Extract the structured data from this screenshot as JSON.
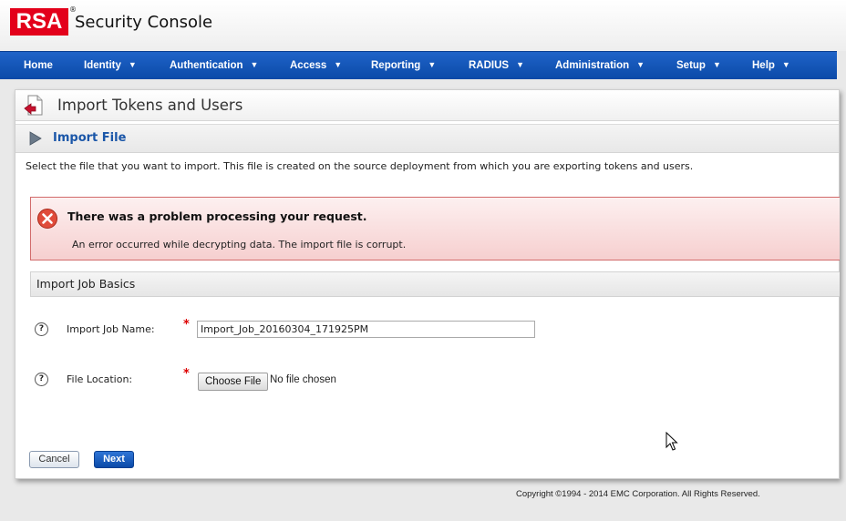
{
  "app": {
    "logo_text": "RSA",
    "logo_registered": "®",
    "title": "Security Console",
    "brand_color": "#e3001b",
    "nav_color": "#0b4aa8"
  },
  "nav": {
    "items": [
      {
        "label": "Home",
        "has_dropdown": false
      },
      {
        "label": "Identity",
        "has_dropdown": true
      },
      {
        "label": "Authentication",
        "has_dropdown": true
      },
      {
        "label": "Access",
        "has_dropdown": true
      },
      {
        "label": "Reporting",
        "has_dropdown": true
      },
      {
        "label": "RADIUS",
        "has_dropdown": true
      },
      {
        "label": "Administration",
        "has_dropdown": true
      },
      {
        "label": "Setup",
        "has_dropdown": true
      },
      {
        "label": "Help",
        "has_dropdown": true
      }
    ],
    "dropdown_glyph": "▼"
  },
  "page": {
    "title": "Import Tokens and Users",
    "icon": "import-document-icon",
    "step_title": "Import File",
    "step_icon": "play-triangle-icon",
    "instructions": "Select the file that you want to import. This file is created on the source deployment from which you are exporting tokens and users."
  },
  "error": {
    "icon": "error-x-icon",
    "title": "There was a problem processing your request.",
    "message": "An error occurred while decrypting data. The import file is corrupt."
  },
  "section": {
    "title": "Import Job Basics"
  },
  "form": {
    "help_glyph": "?",
    "required_glyph": "*",
    "job_name_label": "Import Job Name:",
    "job_name_value": "Import_Job_20160304_171925PM",
    "file_location_label": "File Location:",
    "choose_file_label": "Choose File",
    "file_status": "No file chosen"
  },
  "buttons": {
    "cancel": "Cancel",
    "next": "Next"
  },
  "footer": {
    "copyright": "Copyright ©1994 - 2014 EMC Corporation. All Rights Reserved."
  }
}
